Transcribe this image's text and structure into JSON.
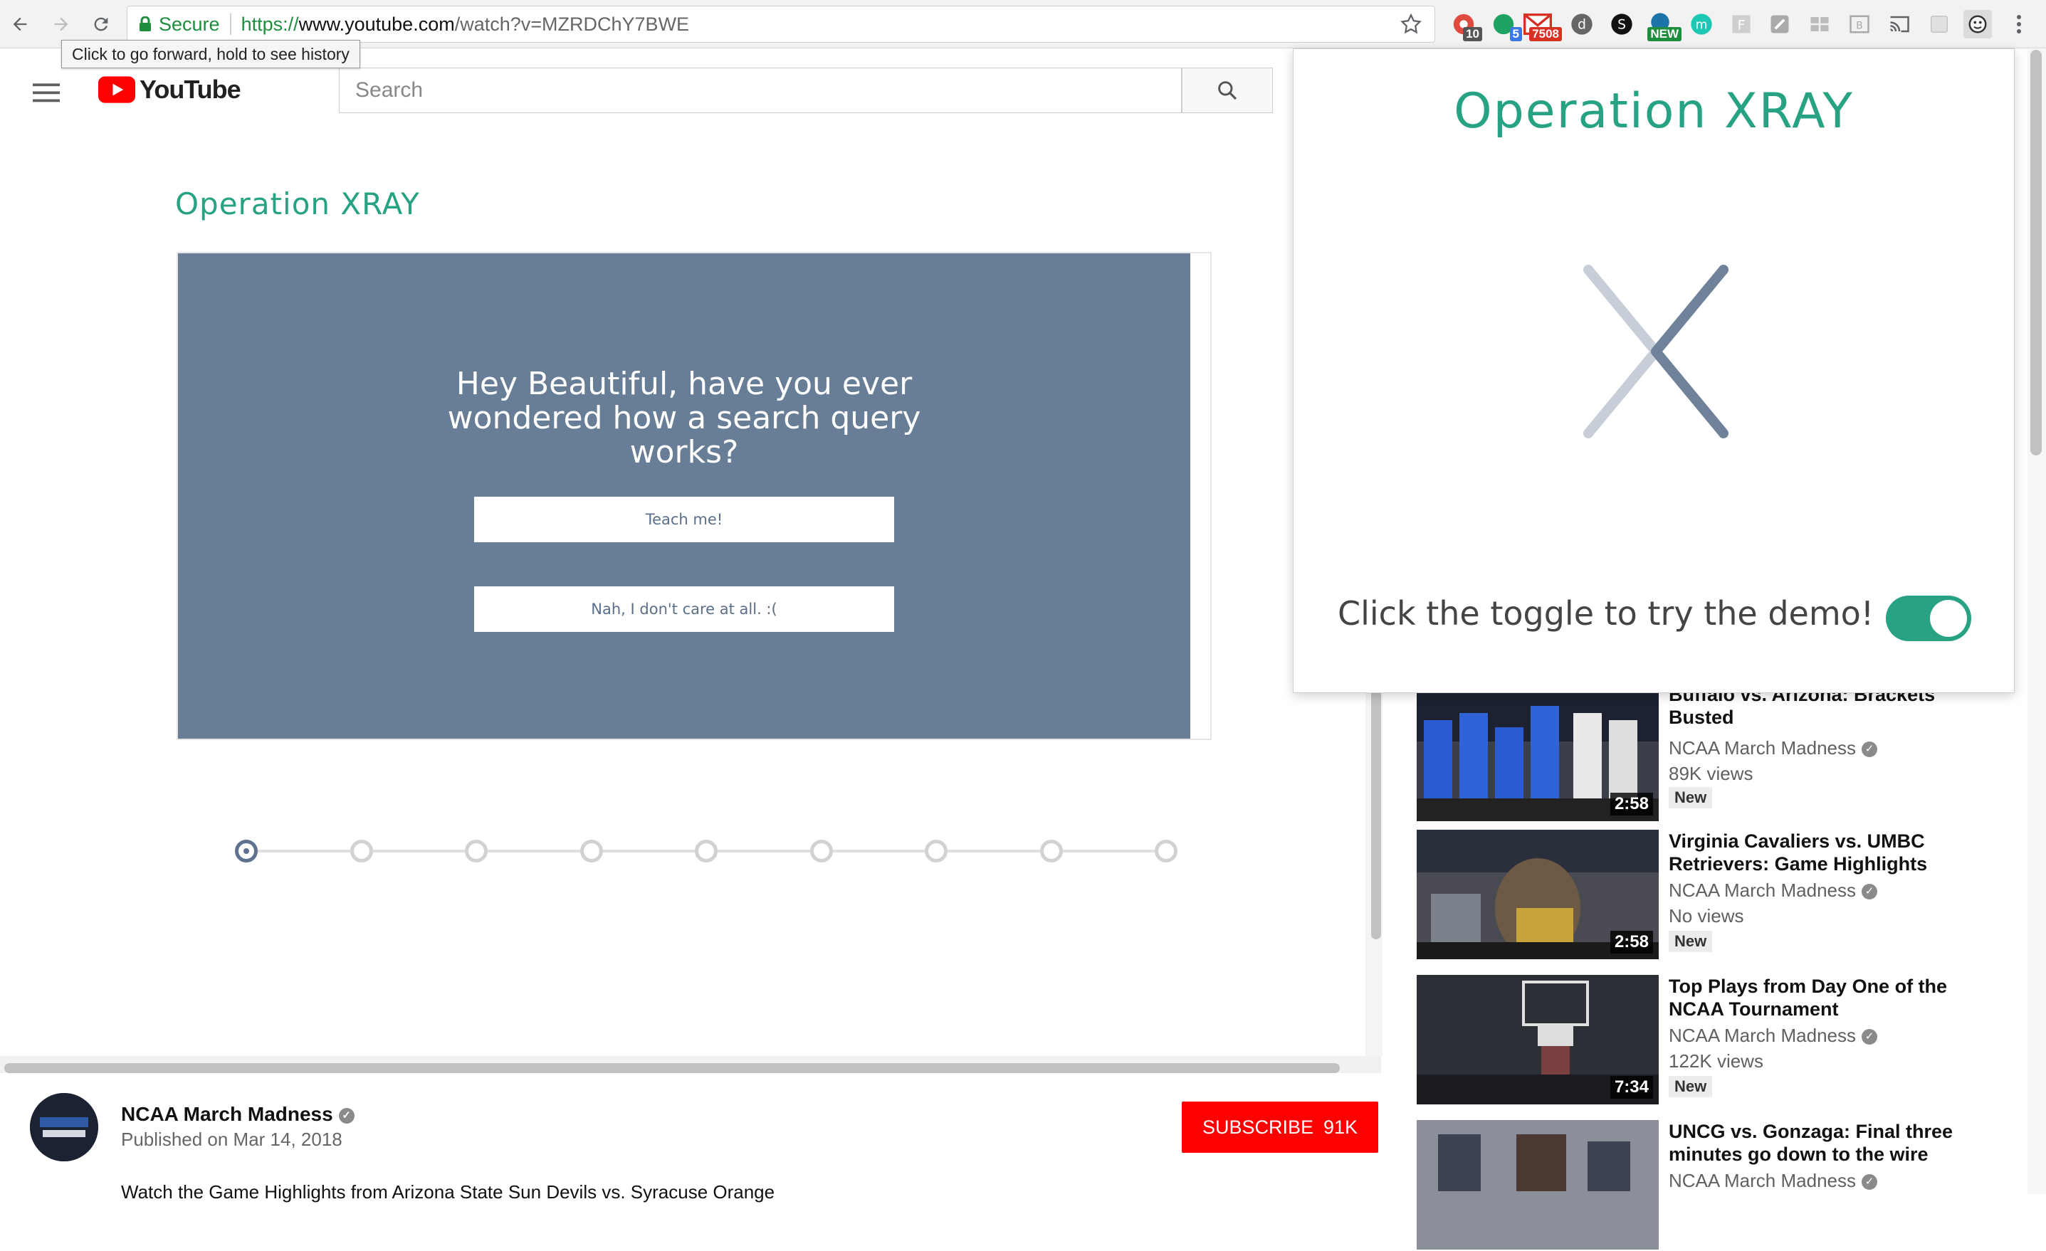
{
  "browser": {
    "secure_label": "Secure",
    "url_scheme": "https://",
    "url_host": "www.youtube.com",
    "url_path": "/watch?v=MZRDChY7BWE",
    "tooltip": "Click to go forward, hold to see history",
    "extensions": [
      {
        "name": "extension-icon-1",
        "badge": "10",
        "badge_color": "#555555"
      },
      {
        "name": "extension-icon-2",
        "badge": "5",
        "badge_color": "#3b78e7"
      },
      {
        "name": "gmail-icon",
        "badge": "7508",
        "badge_color": "#d93025"
      },
      {
        "name": "extension-icon-d"
      },
      {
        "name": "extension-icon-s"
      },
      {
        "name": "extension-icon-new",
        "badge": "NEW",
        "badge_color": "#1e8e3e"
      },
      {
        "name": "extension-icon-m"
      },
      {
        "name": "extension-icon-f"
      },
      {
        "name": "extension-icon-note"
      },
      {
        "name": "extension-icon-grid"
      },
      {
        "name": "extension-icon-b"
      },
      {
        "name": "cast-icon"
      },
      {
        "name": "extension-icon-gray"
      },
      {
        "name": "operation-xray-extension-icon"
      }
    ]
  },
  "youtube": {
    "logo_text": "YouTube",
    "search_placeholder": "Search"
  },
  "xray": {
    "title": "Operation XRAY",
    "question": "Hey Beautiful, have you ever wondered how a search query works?",
    "teach_button": "Teach me!",
    "dismiss_button": "Nah, I don't care at all. :(",
    "progress": {
      "current_step": 1,
      "total_steps": 9
    }
  },
  "channel": {
    "name": "NCAA March Madness",
    "published": "Published on Mar 14, 2018",
    "subscribe_label": "SUBSCRIBE",
    "subscriber_count": "91K",
    "description": "Watch the Game Highlights from Arizona State Sun Devils vs. Syracuse Orange"
  },
  "related": [
    {
      "title": "Buffalo vs. Arizona: Brackets Busted",
      "channel": "NCAA March Madness",
      "views": "89K views",
      "badge": "New",
      "duration": "2:58"
    },
    {
      "title": "Virginia Cavaliers vs. UMBC Retrievers: Game Highlights",
      "channel": "NCAA March Madness",
      "views": "No views",
      "badge": "New",
      "duration": "2:58"
    },
    {
      "title": "Top Plays from Day One of the NCAA Tournament",
      "channel": "NCAA March Madness",
      "views": "122K views",
      "badge": "New",
      "duration": "7:34"
    },
    {
      "title": "UNCG vs. Gonzaga: Final three minutes go down to the wire",
      "channel": "NCAA March Madness"
    }
  ],
  "popup": {
    "title": "Operation XRAY",
    "prompt": "Click the toggle to try the demo!",
    "toggle_on": true,
    "accent_color": "#27a383"
  },
  "colors": {
    "accent": "#27a383",
    "panel": "#687d96",
    "subscribe": "#ff0000"
  }
}
